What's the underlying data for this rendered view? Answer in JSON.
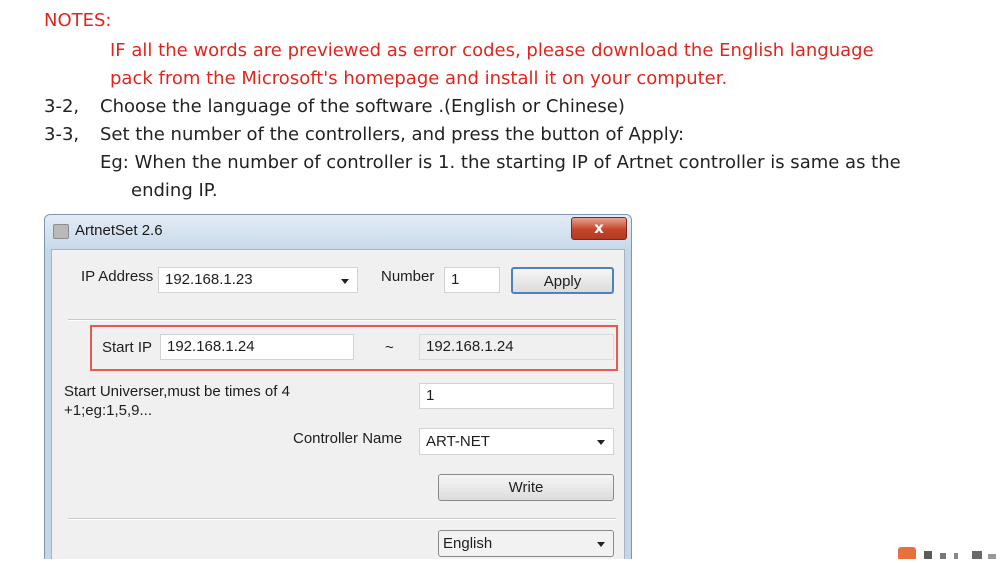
{
  "doc": {
    "notes_title": "NOTES:",
    "notes_lines": [
      "IF all the words are previewed as error codes, please download the English language",
      "pack from the Microsoft's homepage and install it on your computer."
    ],
    "steps": [
      {
        "num": "3-2,",
        "text": "Choose the language of the software .(English or Chinese)"
      },
      {
        "num": "3-3,",
        "text": "Set the number of the controllers, and press the button of Apply:"
      }
    ],
    "example_lines": [
      "Eg: When the number of controller is 1. the starting IP of Artnet controller is same as the",
      "ending IP."
    ]
  },
  "window": {
    "title": "ArtnetSet 2.6",
    "close_glyph": "x",
    "ip_label": "IP Address",
    "ip_value": "192.168.1.23",
    "number_label": "Number",
    "number_value": "1",
    "apply_label": "Apply",
    "start_ip_label": "Start IP",
    "start_ip_value": "192.168.1.24",
    "range_sep": "~",
    "end_ip_value": "192.168.1.24",
    "universe_label_1": "Start Universer,must be times of 4",
    "universe_label_2": "+1;eg:1,5,9...",
    "universe_value": "1",
    "controller_name_label": "Controller Name",
    "controller_name_value": "ART-NET",
    "write_label": "Write",
    "language_value": "English"
  },
  "colors": {
    "note_red": "#e0261c",
    "highlight_red": "#e45a50",
    "window_frame": "#c4d6e8"
  }
}
